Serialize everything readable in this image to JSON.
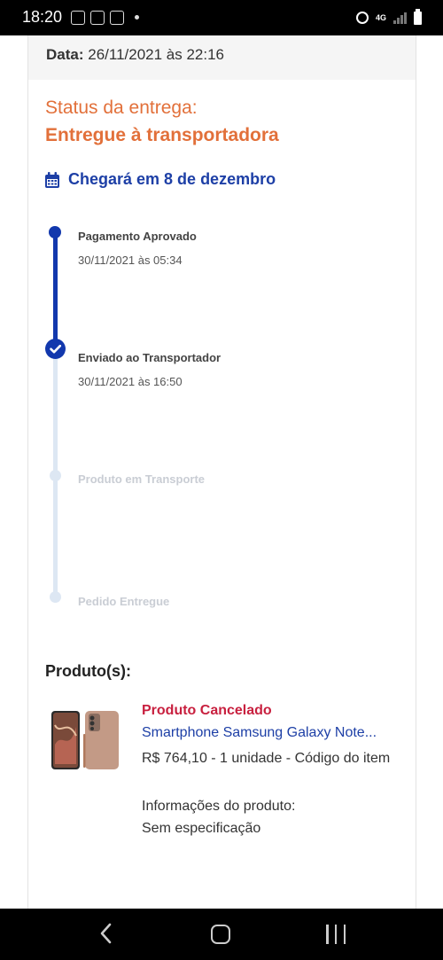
{
  "status_bar": {
    "time": "18:20",
    "network": "4G"
  },
  "order": {
    "date_label": "Data:",
    "date_value": "26/11/2021 às 22:16"
  },
  "delivery": {
    "status_label": "Status da entrega:",
    "status_value": "Entregue à transportadora",
    "arrival_text": "Chegará em 8 de dezembro"
  },
  "timeline": [
    {
      "title": "Pagamento Aprovado",
      "date": "30/11/2021 às 05:34",
      "state": "done"
    },
    {
      "title": "Enviado ao Transportador",
      "date": "30/11/2021 às 16:50",
      "state": "current"
    },
    {
      "title": "Produto em Transporte",
      "date": "",
      "state": "pending"
    },
    {
      "title": "Pedido Entregue",
      "date": "",
      "state": "pending"
    }
  ],
  "products": {
    "heading": "Produto(s):",
    "items": [
      {
        "status": "Produto Cancelado",
        "name": "Smartphone Samsung Galaxy Note...",
        "price_line": "R$ 764,10 - 1 unidade - Código do item",
        "info_label": "Informações do produto:",
        "info_value": "Sem especificação"
      }
    ]
  },
  "colors": {
    "accent_orange": "#e2703a",
    "primary_blue": "#1238ad",
    "link_blue": "#1d3fa6",
    "cancel_red": "#c8203f",
    "timeline_pending": "#dde7f3"
  }
}
